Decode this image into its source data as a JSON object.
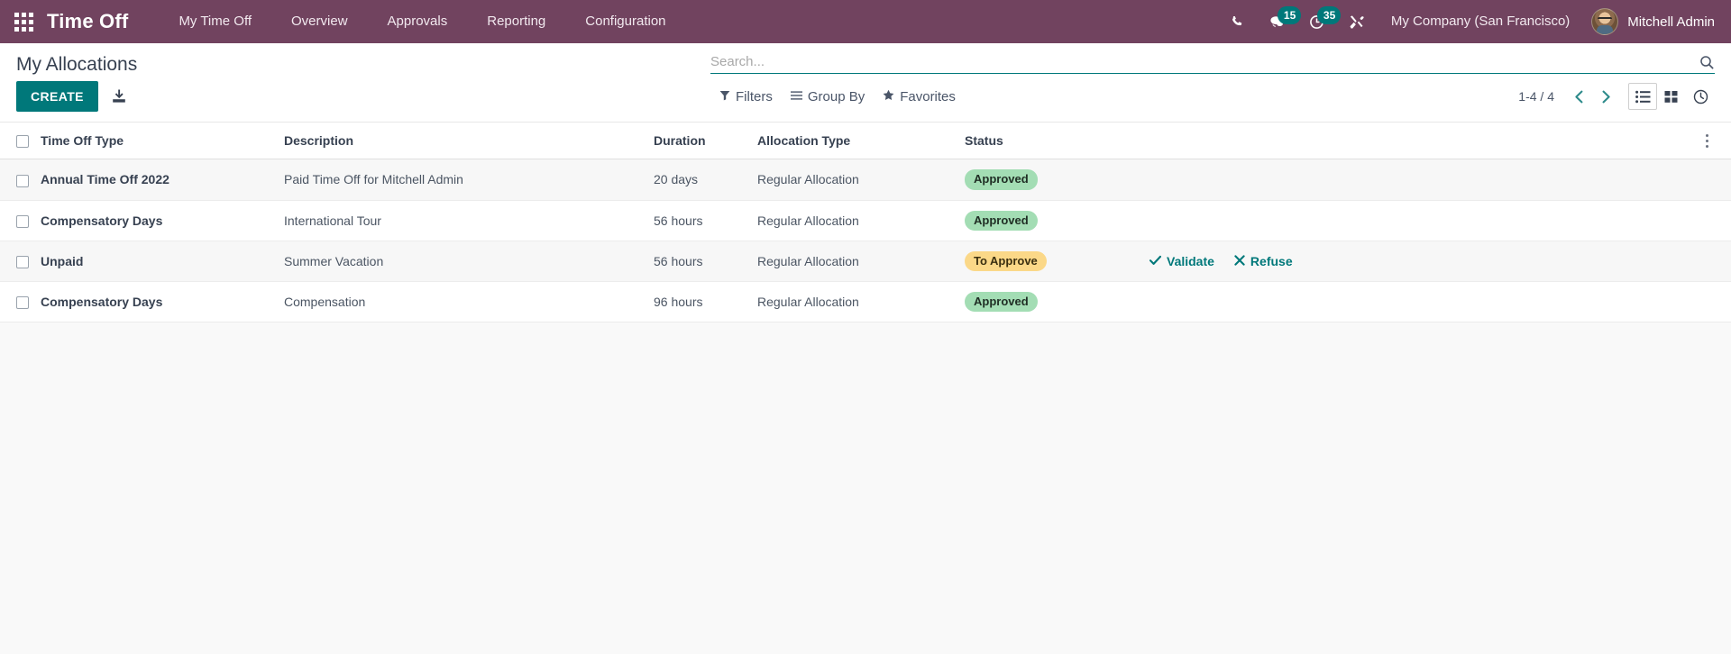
{
  "navbar": {
    "apps_icon": "apps-grid-icon",
    "brand": "Time Off",
    "menu": [
      {
        "label": "My Time Off"
      },
      {
        "label": "Overview"
      },
      {
        "label": "Approvals"
      },
      {
        "label": "Reporting"
      },
      {
        "label": "Configuration"
      }
    ],
    "systray": {
      "phone_icon": "phone-icon",
      "messages_icon": "messages-icon",
      "messages_count": "15",
      "activities_icon": "activity-clock-icon",
      "activities_count": "35",
      "tools_icon": "tools-icon",
      "badge_color": "#00787a"
    },
    "company": "My Company (San Francisco)",
    "user": "Mitchell Admin",
    "avatar_icon": "user-avatar",
    "background_color": "#71435f"
  },
  "control_panel": {
    "title": "My Allocations",
    "create_label": "CREATE",
    "import_icon": "import-download-icon",
    "search": {
      "placeholder": "Search...",
      "value": "",
      "icon": "search-icon"
    },
    "filters": [
      {
        "label": "Filters",
        "icon": "filter-funnel-icon"
      },
      {
        "label": "Group By",
        "icon": "group-by-lines-icon"
      },
      {
        "label": "Favorites",
        "icon": "favorites-star-icon"
      }
    ],
    "pager": {
      "range": "1-4 / 4",
      "prev_icon": "chevron-left-icon",
      "next_icon": "chevron-right-icon"
    },
    "views": [
      {
        "name": "list",
        "icon": "list-view-icon",
        "active": true
      },
      {
        "name": "kanban",
        "icon": "kanban-view-icon",
        "active": false
      },
      {
        "name": "activity",
        "icon": "activity-view-icon",
        "active": false
      }
    ],
    "accent_color": "#00787a"
  },
  "table": {
    "columns": [
      "Time Off Type",
      "Description",
      "Duration",
      "Allocation Type",
      "Status"
    ],
    "optional_columns_icon": "kebab-menu-icon",
    "rows": [
      {
        "type": "Annual Time Off 2022",
        "description": "Paid Time Off for Mitchell Admin",
        "duration": "20 days",
        "allocation_type": "Regular Allocation",
        "status": "Approved",
        "status_style": "approved",
        "actions": []
      },
      {
        "type": "Compensatory Days",
        "description": "International Tour",
        "duration": "56 hours",
        "allocation_type": "Regular Allocation",
        "status": "Approved",
        "status_style": "approved",
        "actions": []
      },
      {
        "type": "Unpaid",
        "description": "Summer Vacation",
        "duration": "56 hours",
        "allocation_type": "Regular Allocation",
        "status": "To Approve",
        "status_style": "toapprove",
        "actions": [
          {
            "label": "Validate",
            "icon": "check-icon"
          },
          {
            "label": "Refuse",
            "icon": "x-icon"
          }
        ]
      },
      {
        "type": "Compensatory Days",
        "description": "Compensation",
        "duration": "96 hours",
        "allocation_type": "Regular Allocation",
        "status": "Approved",
        "status_style": "approved",
        "actions": []
      }
    ],
    "status_colors": {
      "approved_bg": "#a3ddb4",
      "toapprove_bg": "#fbd888"
    }
  }
}
